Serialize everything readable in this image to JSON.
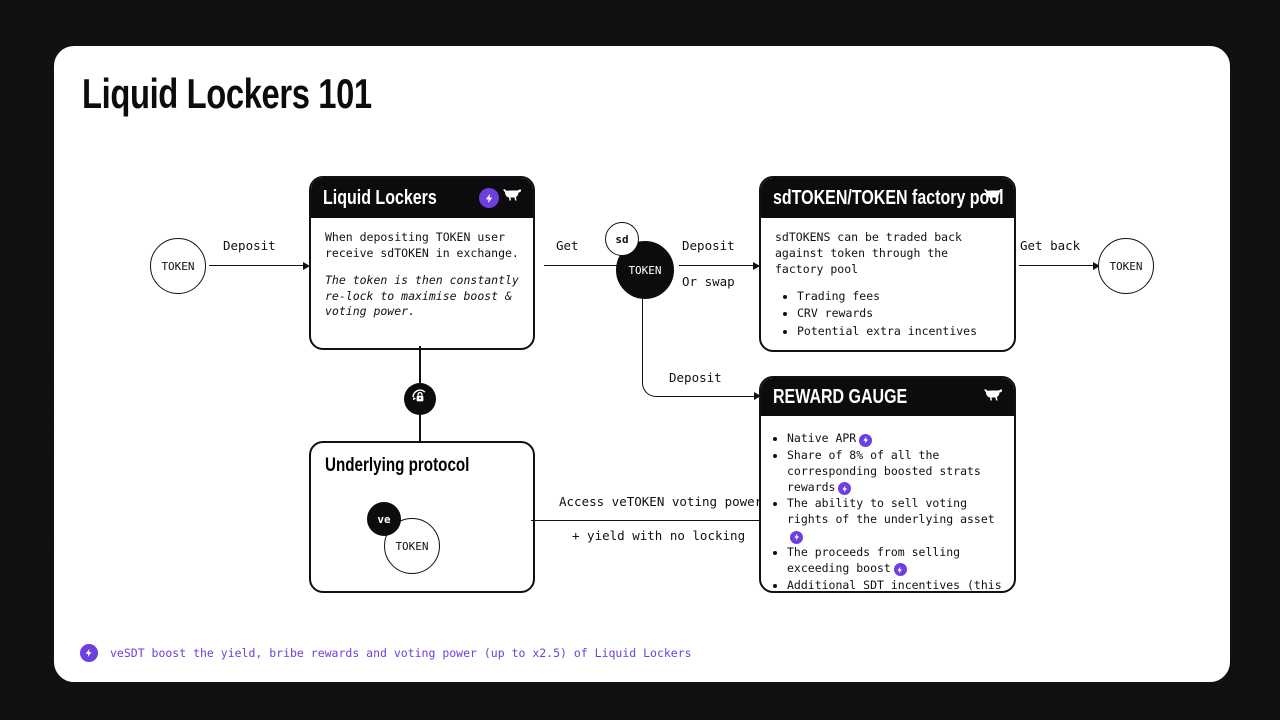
{
  "page": {
    "title": "Liquid Lockers 101",
    "brand_icon": "bison-icon",
    "accent_color": "#6D3FE0",
    "ink_color": "#111113",
    "background_color": "#111113",
    "sheet_color": "#ffffff"
  },
  "nodes": {
    "token_in": {
      "label": "TOKEN"
    },
    "sd_cluster": {
      "badge": "sd",
      "label": "TOKEN"
    },
    "token_out": {
      "label": "TOKEN"
    },
    "ve_cluster": {
      "badge": "ve",
      "label": "TOKEN"
    },
    "relock_badge": {
      "icon": "lock-refresh-icon"
    }
  },
  "cards": {
    "liquid_lockers": {
      "title": "Liquid Lockers",
      "header_icons": [
        "bolt-icon",
        "bison-icon"
      ],
      "paragraph": "When depositing TOKEN user receive sdTOKEN in exchange.",
      "paragraph_italic": "The token is then constantly re-lock to maximise boost & voting power."
    },
    "factory_pool": {
      "title": "sdTOKEN/TOKEN factory pool",
      "header_icons": [
        "bison-icon"
      ],
      "paragraph": "sdTOKENS can be traded back against token through the factory pool",
      "bullets": [
        "Trading fees",
        "CRV rewards",
        "Potential extra incentives"
      ]
    },
    "underlying_protocol": {
      "title": "Underlying protocol"
    },
    "reward_gauge": {
      "title": "REWARD GAUGE",
      "header_icons": [
        "bison-icon"
      ],
      "bullets": [
        {
          "text": "Native APR",
          "bolt": true
        },
        {
          "text": "Share of 8% of all the corresponding boosted strats rewards",
          "bolt": true
        },
        {
          "text": "The ability to sell voting rights of the underlying asset",
          "bolt": true
        },
        {
          "text": "The proceeds from selling exceeding boost",
          "bolt": true
        },
        {
          "text": "Additional SDT incentives (this will be temporary and cease over time)",
          "bolt": false
        }
      ]
    }
  },
  "connectors": {
    "deposit_1": "Deposit",
    "get": "Get",
    "deposit_2": "Deposit",
    "or_swap": "Or swap",
    "get_back": "Get back",
    "deposit_3": "Deposit",
    "access_power": "Access veTOKEN voting power",
    "yield_no_locking": "+ yield with no locking"
  },
  "footer": {
    "icon": "bolt-icon",
    "text": "veSDT boost the yield, bribe rewards and voting power (up to x2.5) of Liquid Lockers"
  }
}
